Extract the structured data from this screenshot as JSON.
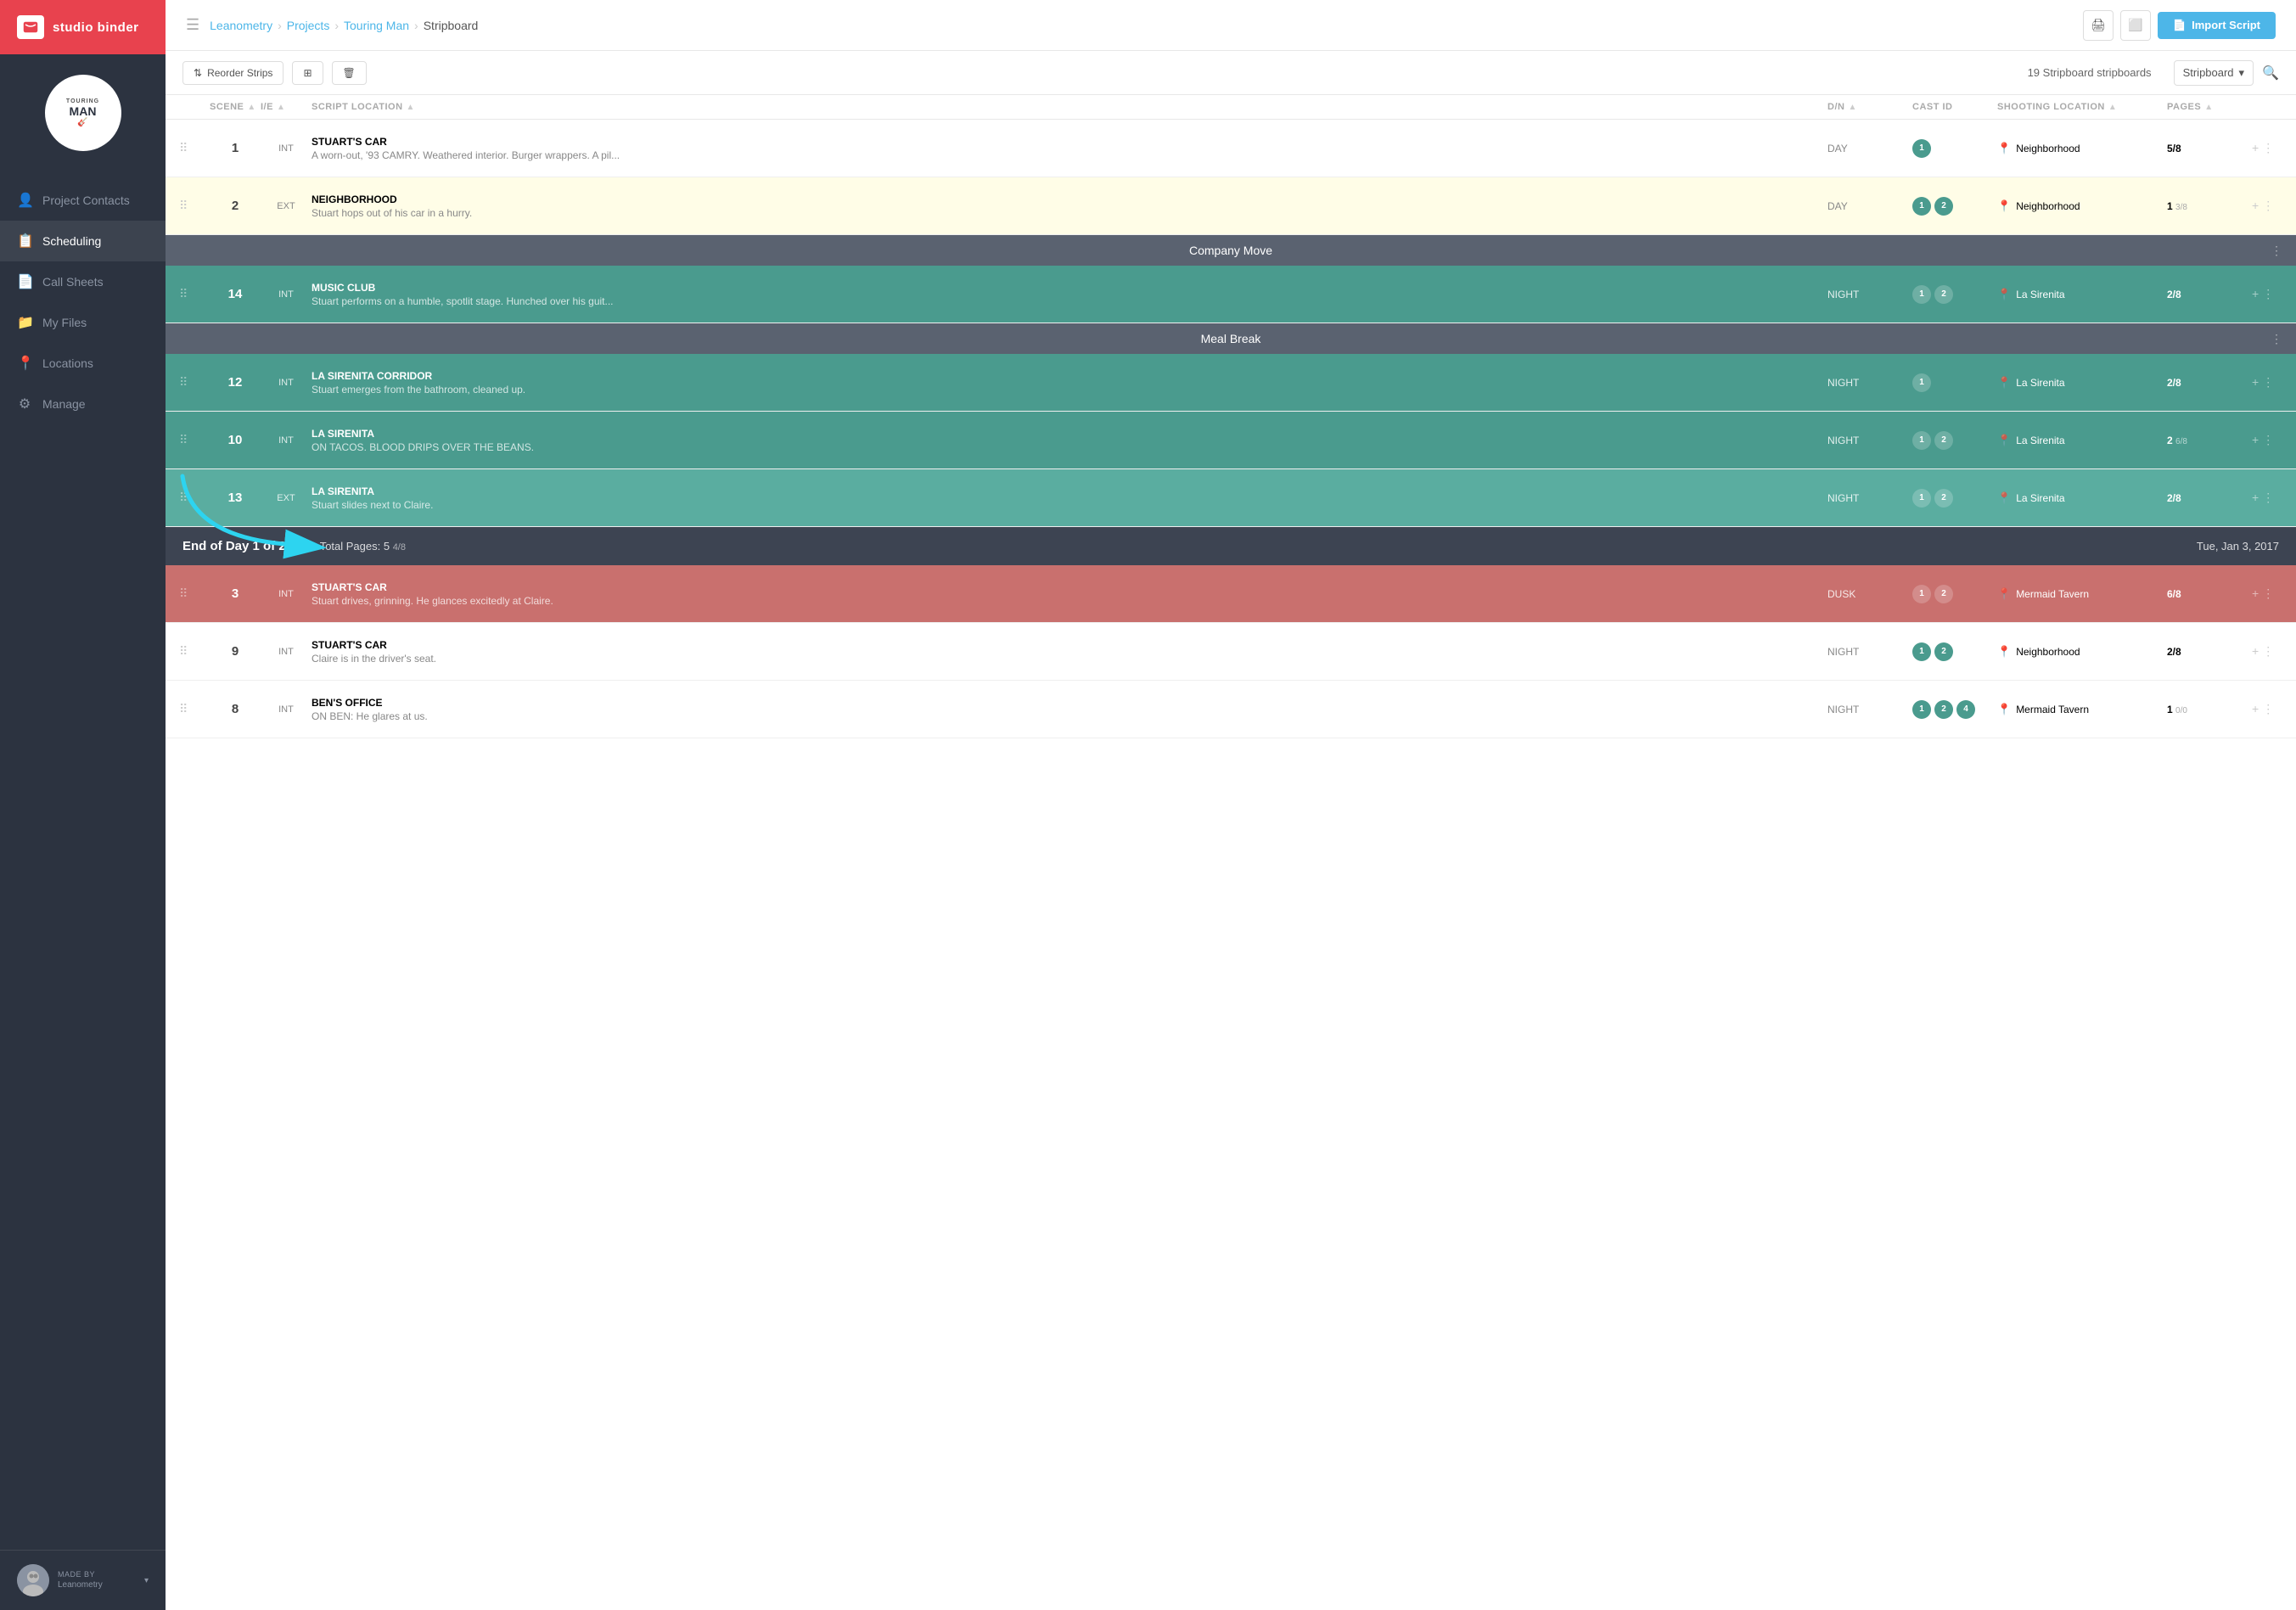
{
  "brand": {
    "name": "studio binder",
    "icon": "💬"
  },
  "project": {
    "logo_text_top": "TOURING",
    "logo_text_main": "MAN",
    "logo_icon": "🎸"
  },
  "breadcrumb": {
    "root": "Leanometry",
    "projects": "Projects",
    "project": "Touring Man",
    "current": "Stripboard"
  },
  "header_actions": {
    "print_label": "🖨",
    "view_label": "⬜",
    "import_label": "Import Script"
  },
  "toolbar": {
    "reorder_label": "Reorder Strips",
    "add_label": "+",
    "delete_label": "🗑",
    "strip_count": "19 Stripboard stripboards",
    "view_mode": "Stripboard",
    "search_icon": "🔍"
  },
  "table": {
    "columns": [
      "",
      "SCENE",
      "I/E",
      "SCRIPT LOCATION",
      "D/N",
      "CAST ID",
      "SHOOTING LOCATION",
      "PAGES",
      ""
    ],
    "rows": [
      {
        "type": "scene",
        "style": "normal",
        "scene": "1",
        "ie": "INT",
        "title": "STUART'S CAR",
        "desc": "A worn-out, '93 CAMRY. Weathered interior. Burger wrappers. A pil...",
        "dn": "DAY",
        "cast_ids": [
          "1"
        ],
        "location": "Neighborhood",
        "pages_main": "5/8",
        "pages_sub": ""
      },
      {
        "type": "scene",
        "style": "highlighted",
        "scene": "2",
        "ie": "EXT",
        "title": "NEIGHBORHOOD",
        "desc": "Stuart hops out of his car in a hurry.",
        "dn": "DAY",
        "cast_ids": [
          "1",
          "2"
        ],
        "location": "Neighborhood",
        "pages_main": "1",
        "pages_sub": "3/8"
      },
      {
        "type": "divider",
        "label": "Company Move"
      },
      {
        "type": "scene",
        "style": "teal",
        "scene": "14",
        "ie": "INT",
        "title": "MUSIC CLUB",
        "desc": "Stuart performs on a humble, spotlit stage. Hunched over his guit...",
        "dn": "NIGHT",
        "cast_ids": [
          "1",
          "2"
        ],
        "location": "La Sirenita",
        "pages_main": "2/8",
        "pages_sub": ""
      },
      {
        "type": "divider",
        "label": "Meal Break"
      },
      {
        "type": "scene",
        "style": "teal",
        "scene": "12",
        "ie": "INT",
        "title": "LA SIRENITA CORRIDOR",
        "desc": "Stuart emerges from the bathroom, cleaned up.",
        "dn": "NIGHT",
        "cast_ids": [
          "1"
        ],
        "location": "La Sirenita",
        "pages_main": "2/8",
        "pages_sub": ""
      },
      {
        "type": "scene",
        "style": "teal",
        "scene": "10",
        "ie": "INT",
        "title": "LA SIRENITA",
        "desc": "ON TACOS. BLOOD DRIPS OVER THE BEANS.",
        "dn": "NIGHT",
        "cast_ids": [
          "1",
          "2"
        ],
        "location": "La Sirenita",
        "pages_main": "2",
        "pages_sub": "6/8"
      },
      {
        "type": "scene",
        "style": "teal-light",
        "scene": "13",
        "ie": "EXT",
        "title": "LA SIRENITA",
        "desc": "Stuart slides next to Claire.",
        "dn": "NIGHT",
        "cast_ids": [
          "1",
          "2"
        ],
        "location": "La Sirenita",
        "pages_main": "2/8",
        "pages_sub": ""
      },
      {
        "type": "end-of-day",
        "label": "End of Day 1 of 2",
        "total_pages_label": "Total Pages:",
        "total_pages": "5",
        "total_pages_sub": "4/8",
        "date": "Tue, Jan 3, 2017"
      },
      {
        "type": "scene",
        "style": "pink",
        "scene": "3",
        "ie": "INT",
        "title": "STUART'S CAR",
        "desc": "Stuart drives, grinning. He glances excitedly at Claire.",
        "dn": "DUSK",
        "cast_ids": [
          "1",
          "2"
        ],
        "location": "Mermaid Tavern",
        "pages_main": "6/8",
        "pages_sub": ""
      },
      {
        "type": "scene",
        "style": "normal",
        "scene": "9",
        "ie": "INT",
        "title": "STUART'S CAR",
        "desc": "Claire is in the driver's seat.",
        "dn": "NIGHT",
        "cast_ids": [
          "1",
          "2"
        ],
        "location": "Neighborhood",
        "pages_main": "2/8",
        "pages_sub": ""
      },
      {
        "type": "scene",
        "style": "normal",
        "scene": "8",
        "ie": "INT",
        "title": "BEN'S OFFICE",
        "desc": "ON BEN: He glares at us.",
        "dn": "NIGHT",
        "cast_ids": [
          "1",
          "2",
          "4"
        ],
        "location": "Mermaid Tavern",
        "pages_main": "1",
        "pages_sub": "0/0"
      }
    ]
  },
  "nav": {
    "items": [
      {
        "label": "Project Contacts",
        "icon": "👤",
        "active": false
      },
      {
        "label": "Scheduling",
        "icon": "📋",
        "active": true
      },
      {
        "label": "Call Sheets",
        "icon": "📄",
        "active": false
      },
      {
        "label": "My Files",
        "icon": "📁",
        "active": false
      },
      {
        "label": "Locations",
        "icon": "📍",
        "active": false
      },
      {
        "label": "Manage",
        "icon": "⚙",
        "active": false
      }
    ]
  },
  "footer": {
    "made_by": "MADE BY",
    "company": "Leanometry"
  }
}
